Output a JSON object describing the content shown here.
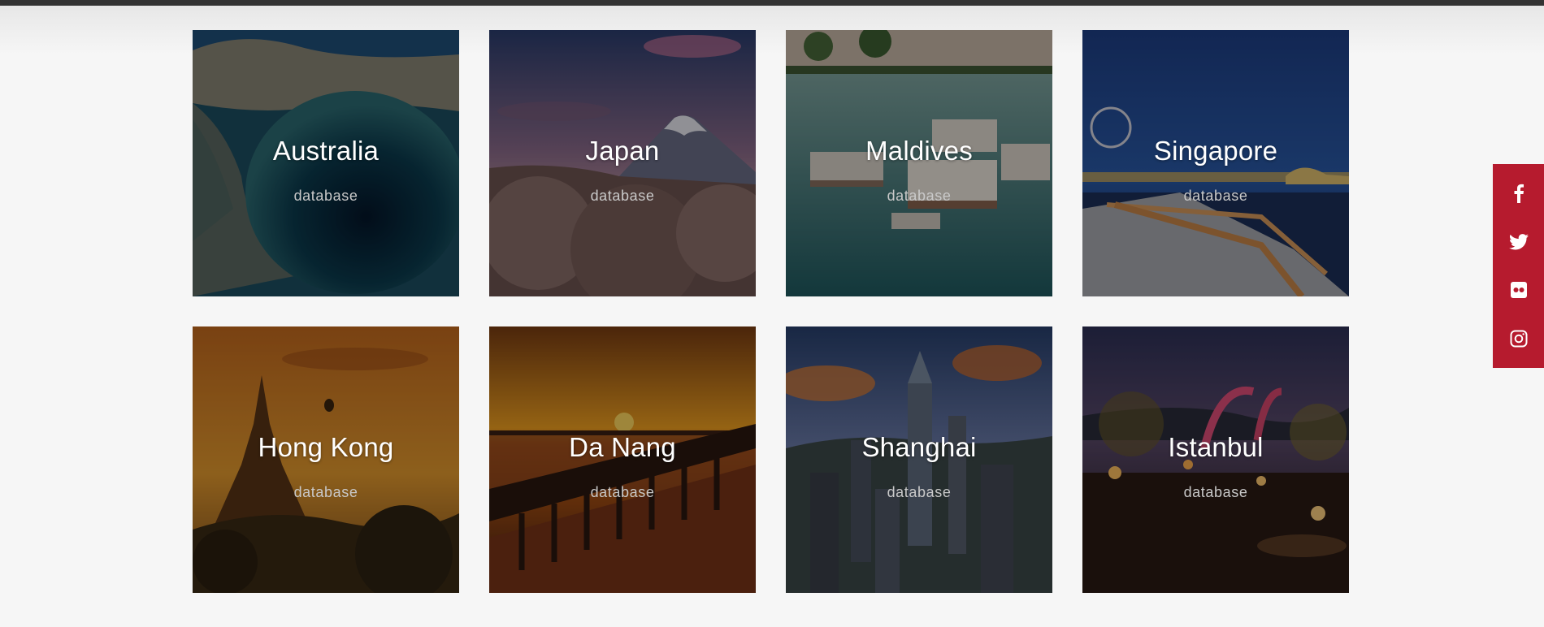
{
  "destinations": [
    {
      "name": "Australia",
      "subtitle": "database",
      "scene": "ocean-blue-hole"
    },
    {
      "name": "Japan",
      "subtitle": "database",
      "scene": "mount-fuji-blossoms"
    },
    {
      "name": "Maldives",
      "subtitle": "database",
      "scene": "water-villas"
    },
    {
      "name": "Singapore",
      "subtitle": "database",
      "scene": "marina-bay-night"
    },
    {
      "name": "Hong Kong",
      "subtitle": "database",
      "scene": "temple-sunset"
    },
    {
      "name": "Da Nang",
      "subtitle": "database",
      "scene": "pier-sunset"
    },
    {
      "name": "Shanghai",
      "subtitle": "database",
      "scene": "city-skyline"
    },
    {
      "name": "Istanbul",
      "subtitle": "database",
      "scene": "night-market"
    }
  ],
  "social": [
    {
      "icon": "facebook-icon"
    },
    {
      "icon": "twitter-icon"
    },
    {
      "icon": "flickr-icon"
    },
    {
      "icon": "instagram-icon"
    }
  ],
  "colors": {
    "accent": "#b61b2e",
    "background": "#f6f6f6",
    "topbar": "#333333"
  }
}
